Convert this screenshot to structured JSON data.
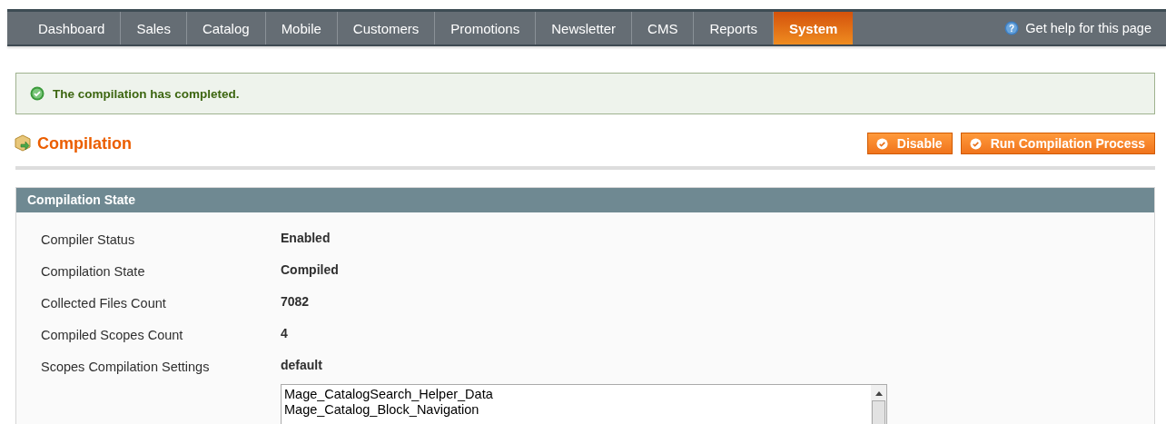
{
  "nav": {
    "tabs": [
      {
        "label": "Dashboard",
        "selected": false
      },
      {
        "label": "Sales",
        "selected": false
      },
      {
        "label": "Catalog",
        "selected": false
      },
      {
        "label": "Mobile",
        "selected": false
      },
      {
        "label": "Customers",
        "selected": false
      },
      {
        "label": "Promotions",
        "selected": false
      },
      {
        "label": "Newsletter",
        "selected": false
      },
      {
        "label": "CMS",
        "selected": false
      },
      {
        "label": "Reports",
        "selected": false
      },
      {
        "label": "System",
        "selected": true
      }
    ],
    "help_icon": "?",
    "help_link": "Get help for this page"
  },
  "message": {
    "kind": "success",
    "text": "The compilation has completed."
  },
  "page_title": "Compilation",
  "buttons": [
    "Disable",
    "Run Compilation Process"
  ],
  "section": {
    "title": "Compilation State",
    "rows": [
      {
        "label": "Compiler Status",
        "value": "Enabled"
      },
      {
        "label": "Compilation State",
        "value": "Compiled"
      },
      {
        "label": "Collected Files Count",
        "value": "7082"
      },
      {
        "label": "Compiled Scopes Count",
        "value": "4"
      },
      {
        "label": "Scopes Compilation Settings",
        "value": "default"
      }
    ],
    "scopes_list": [
      "Mage_CatalogSearch_Helper_Data",
      "Mage_Catalog_Block_Navigation"
    ]
  }
}
